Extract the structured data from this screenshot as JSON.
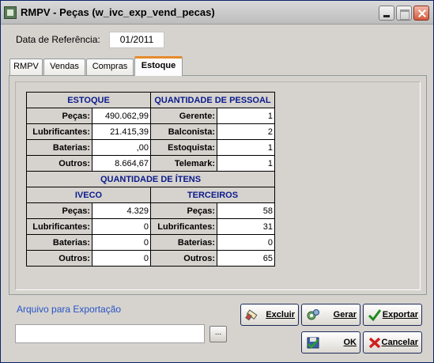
{
  "window": {
    "title": "RMPV - Peças (w_ivc_exp_vend_pecas)"
  },
  "reference": {
    "label": "Data de Referência:",
    "value": "01/2011"
  },
  "tabs": [
    {
      "label": "RMPV"
    },
    {
      "label": "Vendas"
    },
    {
      "label": "Compras"
    },
    {
      "label": "Estoque"
    }
  ],
  "active_tab": "Estoque",
  "estoque": {
    "header": "ESTOQUE",
    "rows": [
      {
        "label": "Peças:",
        "value": "490.062,99"
      },
      {
        "label": "Lubrificantes:",
        "value": "21.415,39"
      },
      {
        "label": "Baterias:",
        "value": ",00"
      },
      {
        "label": "Outros:",
        "value": "8.664,67"
      }
    ]
  },
  "pessoal": {
    "header": "QUANTIDADE DE PESSOAL",
    "rows": [
      {
        "label": "Gerente:",
        "value": "1"
      },
      {
        "label": "Balconista:",
        "value": "2"
      },
      {
        "label": "Estoquista:",
        "value": "1"
      },
      {
        "label": "Telemark:",
        "value": "1"
      }
    ]
  },
  "itens": {
    "header": "QUANTIDADE DE ÍTENS",
    "iveco": {
      "header": "IVECO",
      "rows": [
        {
          "label": "Peças:",
          "value": "4.329"
        },
        {
          "label": "Lubrificantes:",
          "value": "0"
        },
        {
          "label": "Baterias:",
          "value": "0"
        },
        {
          "label": "Outros:",
          "value": "0"
        }
      ]
    },
    "terceiros": {
      "header": "TERCEIROS",
      "rows": [
        {
          "label": "Peças:",
          "value": "58"
        },
        {
          "label": "Lubrificantes:",
          "value": "31"
        },
        {
          "label": "Baterias:",
          "value": "0"
        },
        {
          "label": "Outros:",
          "value": "65"
        }
      ]
    }
  },
  "export": {
    "label": "Arquivo para Exportação",
    "value": "",
    "browse_label": "..."
  },
  "buttons": {
    "excluir": "Excluir",
    "gerar": "Gerar",
    "exportar": "Exportar",
    "ok": "OK",
    "cancelar": "Cancelar"
  },
  "colors": {
    "tab_accent": "#e68b2c",
    "header_text": "#0a1a8c",
    "link_label": "#2653c7"
  }
}
